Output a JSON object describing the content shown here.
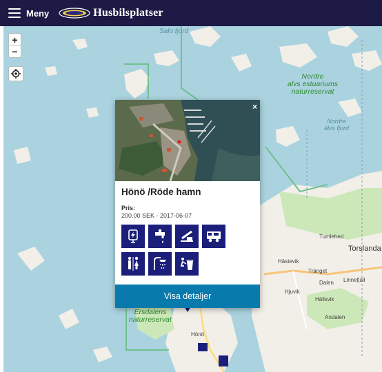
{
  "header": {
    "menu_label": "Meny",
    "logo_text": "Husbilsplatser",
    "icons": [
      "hamburger-icon",
      "logo-emblem"
    ]
  },
  "map": {
    "zoom_in": "+",
    "zoom_out": "−",
    "labels": {
      "salo_fjord": "Salo fjord",
      "nordre_reserve": "Nordre\nalvs estuariums\nnaturreservat",
      "nordre_fjord": "Nordre\nälvs fjord",
      "ersdalens": "Ersdalens\nnaturreservat",
      "tumlehed": "Tumlehed",
      "torslanda": "Torslanda",
      "hastevik": "Hästevik",
      "tranget": "Tränget",
      "dalen": "Dalen",
      "linnefjall": "Linnefjäll",
      "hjuvik": "Hjuvik",
      "hallsvik": "Hällsvik",
      "andalen": "Andalen",
      "hono": "Hönö"
    },
    "colors": {
      "water": "#aad3df",
      "land": "#f2efe9",
      "green": "#cde8b8",
      "boundary": "#6fbf8e"
    }
  },
  "popup": {
    "title": "Hönö /Röde hamn",
    "price_label": "Pris:",
    "price_value": "200.00 SEK - 2017-06-07",
    "close": "×",
    "details_button": "Visa detaljer",
    "amenities": [
      "electricity-icon",
      "water-tap-icon",
      "waste-disposal-icon",
      "motorhome-icon",
      "toilet-icon",
      "shower-icon",
      "trash-bin-icon"
    ],
    "colors": {
      "icon_bg": "#1b1f7a",
      "button_bg": "#087aab"
    }
  }
}
